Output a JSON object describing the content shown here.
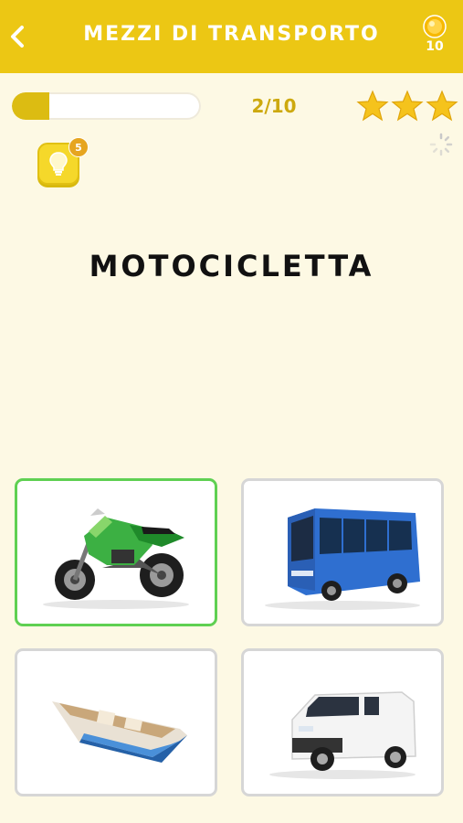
{
  "header": {
    "title": "MEZZI DI TRANSPORTO",
    "back_icon": "chevron-left-icon",
    "coins": "10",
    "coin_icon": "gold-coin-icon",
    "background_color": "#ecc714"
  },
  "progress": {
    "fraction": 0.2,
    "counter": "2/10",
    "fill_color": "#dcbc12"
  },
  "stars": {
    "count": 3,
    "icon": "star-icon",
    "color": "#f5c31c"
  },
  "hint": {
    "icon": "lightbulb-icon",
    "badge": "5"
  },
  "loading_icon": "spinner-icon",
  "question": {
    "word": "MOTOCICLETTA"
  },
  "answers": [
    {
      "image": "motorcycle-image",
      "selected": true
    },
    {
      "image": "bus-image",
      "selected": false
    },
    {
      "image": "boat-image",
      "selected": false
    },
    {
      "image": "van-image",
      "selected": false
    }
  ],
  "colors": {
    "selected_border": "#5fd052",
    "card_border": "#d6d6d6",
    "page_background": "#fdf9e4"
  }
}
